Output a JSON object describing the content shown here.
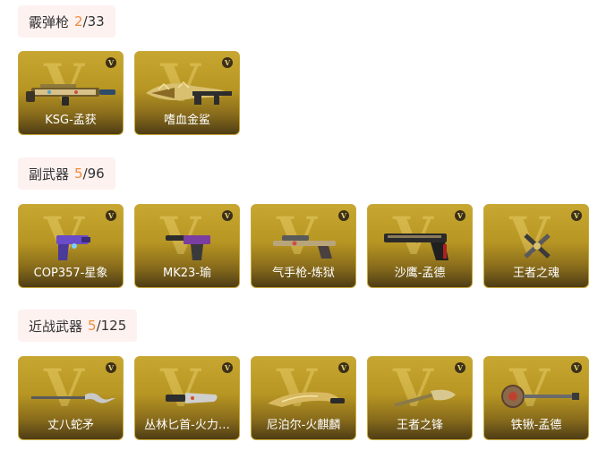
{
  "sections": [
    {
      "title": "霰弹枪",
      "owned": "2",
      "total": "/33",
      "items": [
        {
          "label": "KSG-孟获",
          "icon": "shotgun-ksg-icon"
        },
        {
          "label": "嗜血金鲨",
          "icon": "shotgun-gold-shark-icon"
        }
      ]
    },
    {
      "title": "副武器",
      "owned": "5",
      "total": "/96",
      "items": [
        {
          "label": "COP357-星象",
          "icon": "pistol-cop357-icon"
        },
        {
          "label": "MK23-瑜",
          "icon": "pistol-mk23-icon"
        },
        {
          "label": "气手枪-炼狱",
          "icon": "air-pistol-icon"
        },
        {
          "label": "沙鹰-孟德",
          "icon": "desert-eagle-icon"
        },
        {
          "label": "王者之魂",
          "icon": "king-soul-icon"
        }
      ]
    },
    {
      "title": "近战武器",
      "owned": "5",
      "total": "/125",
      "items": [
        {
          "label": "丈八蛇矛",
          "icon": "serpent-spear-icon"
        },
        {
          "label": "丛林匕首-火力…",
          "icon": "jungle-dagger-icon"
        },
        {
          "label": "尼泊尔-火麒麟",
          "icon": "kukri-icon"
        },
        {
          "label": "王者之锋",
          "icon": "king-blade-icon"
        },
        {
          "label": "铁锹-孟德",
          "icon": "shovel-icon"
        }
      ]
    }
  ],
  "badge_letter": "V",
  "watermark_letter": "V",
  "colors": {
    "owned_count": "#f08c3a",
    "header_bg": "#fdf2f0",
    "card_gold": "#c7a631"
  }
}
